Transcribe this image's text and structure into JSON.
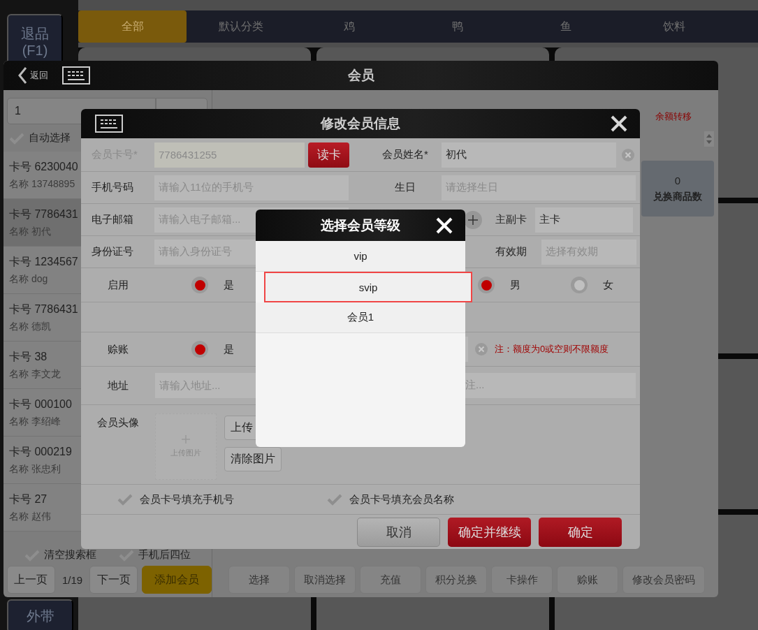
{
  "side_buttons": [
    {
      "label": "退品",
      "shortcut": "(F1)"
    },
    {
      "label": "外带"
    }
  ],
  "category_tabs": [
    {
      "label": "全部",
      "selected": true
    },
    {
      "label": "默认分类",
      "selected": false
    },
    {
      "label": "鸡",
      "selected": false
    },
    {
      "label": "鸭",
      "selected": false
    },
    {
      "label": "鱼",
      "selected": false
    },
    {
      "label": "饮料",
      "selected": false
    }
  ],
  "member_window": {
    "back_label": "返回",
    "title": "会员",
    "search": {
      "value": "1"
    },
    "auto_select": {
      "label": "自动选择",
      "checked": false
    },
    "members": [
      {
        "card": "卡号 6230040",
        "name": "名称 13748895",
        "selected": false
      },
      {
        "card": "卡号 7786431",
        "name": "名称 初代",
        "selected": true
      },
      {
        "card": "卡号 1234567",
        "name": "名称 dog",
        "selected": false
      },
      {
        "card": "卡号 7786431",
        "name": "名称 德凯",
        "selected": false
      },
      {
        "card": "卡号 38",
        "name": "名称 李文龙",
        "selected": false
      },
      {
        "card": "卡号 000100",
        "name": "名称 李绍峰",
        "selected": false
      },
      {
        "card": "卡号 000219",
        "name": "名称 张忠利",
        "selected": false
      },
      {
        "card": "卡号 27",
        "name": "名称 赵伟",
        "selected": false
      }
    ],
    "clear_search": {
      "label": "清空搜索框",
      "checked": false
    },
    "phone_last_four": {
      "label": "手机后四位",
      "checked": false
    },
    "pager": {
      "prev": "上一页",
      "page": "1/19",
      "next": "下一页",
      "add": "添加会员"
    },
    "balance_transfer": "余额转移",
    "stat": {
      "value": "0",
      "label": "兑换商品数"
    },
    "actions": [
      "选择",
      "取消选择",
      "充值",
      "积分兑换",
      "卡操作",
      "赊账",
      "修改会员密码"
    ]
  },
  "edit_dialog": {
    "title": "修改会员信息",
    "card_no": {
      "label": "会员卡号*",
      "value": "7786431255",
      "disabled": true
    },
    "read_card": "读卡",
    "name": {
      "label": "会员姓名*",
      "value": "初代"
    },
    "phone": {
      "label": "手机号码",
      "placeholder": "请输入11位的手机号"
    },
    "birthday": {
      "label": "生日",
      "placeholder": "请选择生日"
    },
    "email": {
      "label": "电子邮箱",
      "placeholder": "请输入电子邮箱..."
    },
    "card_type": {
      "label": "主副卡",
      "value": "主卡"
    },
    "id_no": {
      "label": "身份证号",
      "placeholder": "请输入身份证号"
    },
    "expiry": {
      "label": "有效期",
      "placeholder": "选择有效期"
    },
    "enabled": {
      "label": "启用",
      "options": [
        {
          "label": "是",
          "selected": true
        }
      ]
    },
    "gender": {
      "options": [
        {
          "label": "男",
          "selected": true
        },
        {
          "label": "女",
          "selected": false
        }
      ]
    },
    "credit": {
      "label": "赊账",
      "options": [
        {
          "label": "是",
          "selected": true
        }
      ]
    },
    "credit_note": "注：额度为0或空则不限额度",
    "address": {
      "label": "地址",
      "placeholder": "请输入地址..."
    },
    "remark": {
      "placeholder": "注..."
    },
    "avatar": {
      "label": "会员头像",
      "upload_hint": "上传图片",
      "upload_button": "上传",
      "clear_button": "清除图片"
    },
    "fill_options": [
      {
        "label": "会员卡号填充手机号",
        "checked": false
      },
      {
        "label": "会员卡号填充会员名称",
        "checked": false
      }
    ],
    "buttons": [
      {
        "label": "取消",
        "kind": "secondary"
      },
      {
        "label": "确定并继续",
        "kind": "primary"
      },
      {
        "label": "确定",
        "kind": "primary"
      }
    ]
  },
  "level_picker": {
    "title": "选择会员等级",
    "levels": [
      {
        "label": "vip",
        "selected": false
      },
      {
        "label": "svip",
        "selected": true
      },
      {
        "label": "会员1",
        "selected": false
      }
    ]
  }
}
